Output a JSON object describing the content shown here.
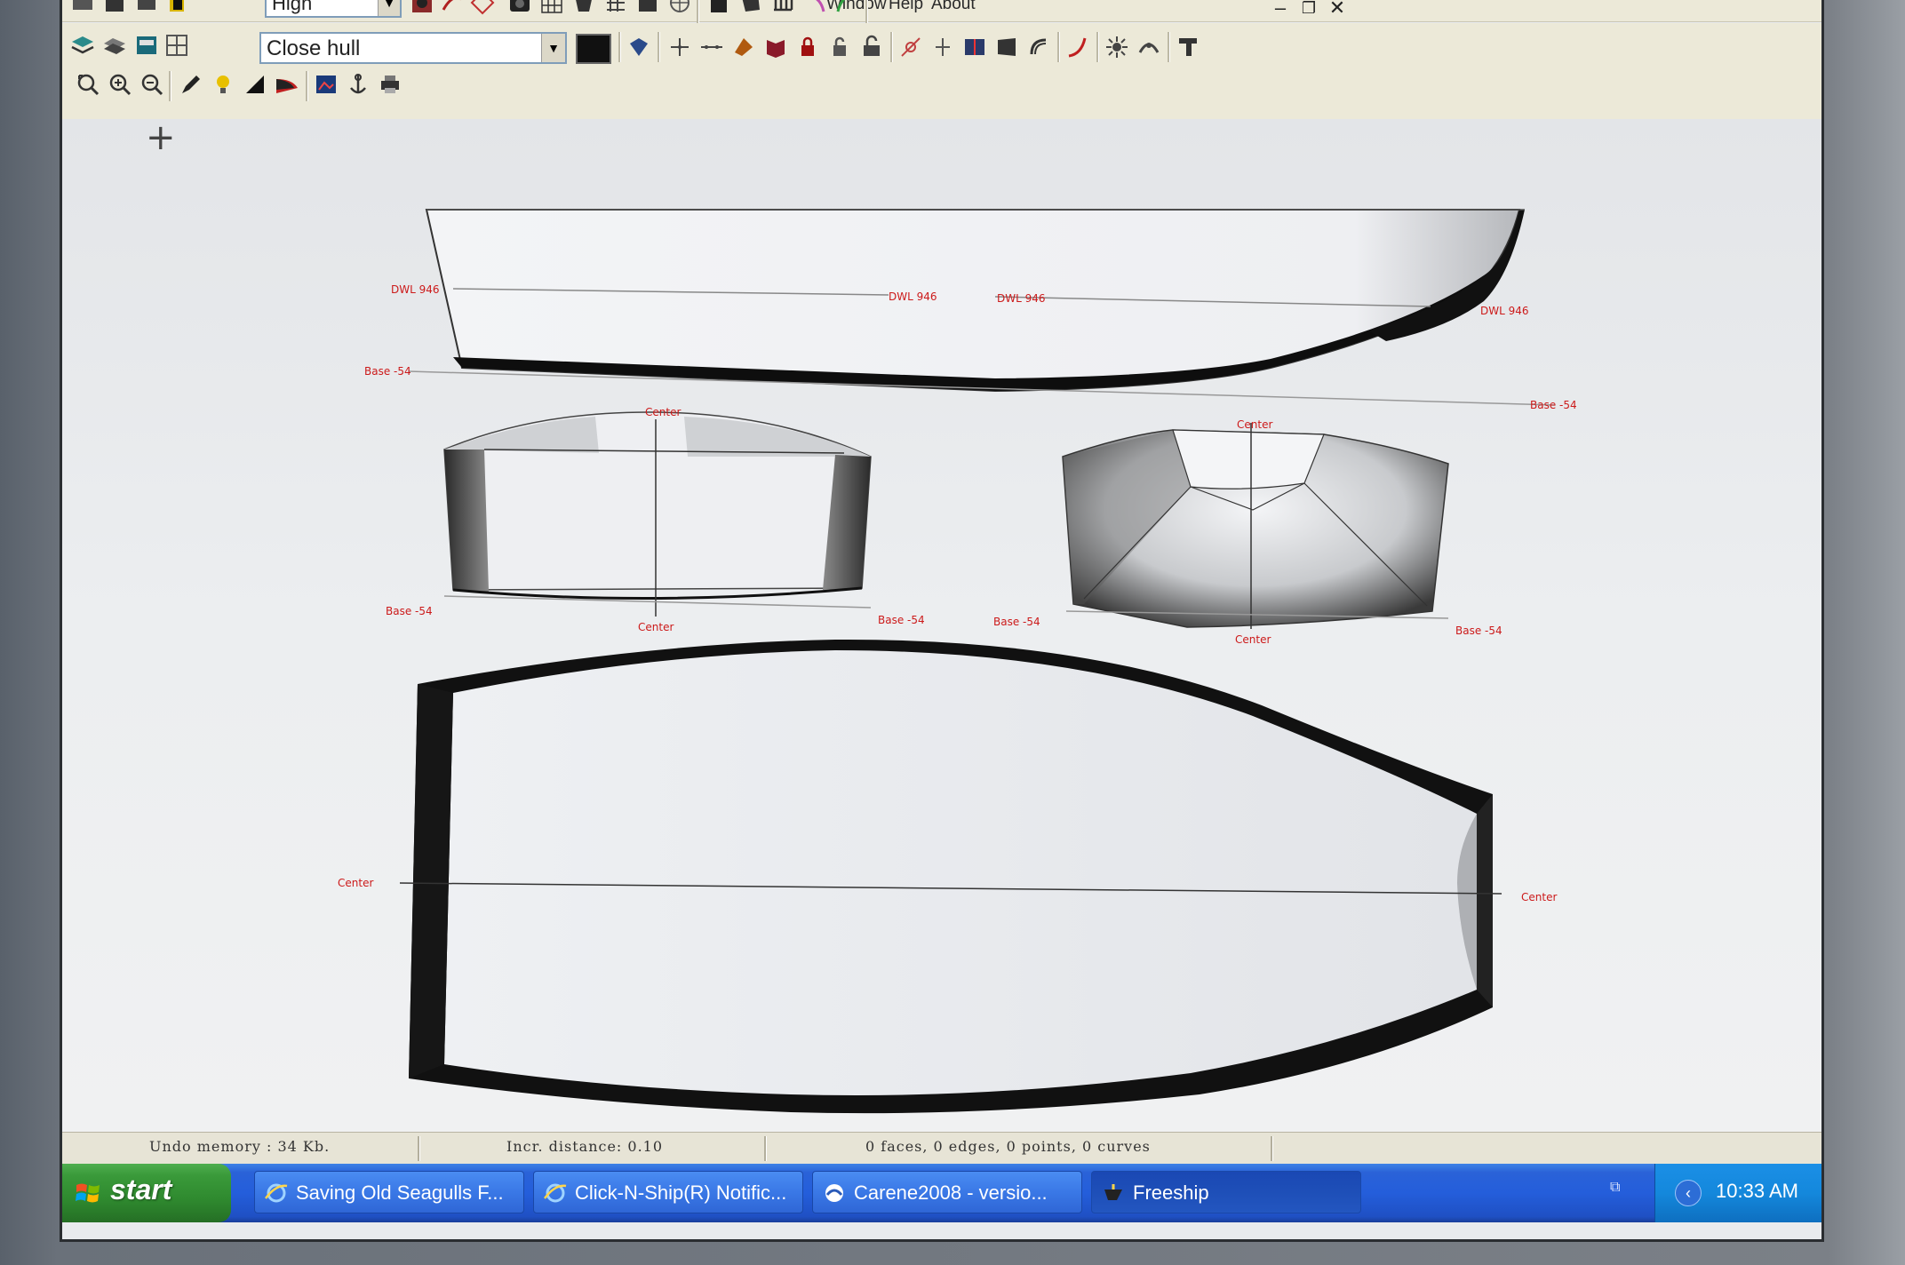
{
  "app": {
    "menu": [
      "Window",
      "Help",
      "About"
    ],
    "window_controls": {
      "minimize": "–",
      "restore": "❐",
      "close": "✕"
    }
  },
  "toolbar": {
    "precision_select": "High",
    "layer_select": "Close hull",
    "color_swatch": "#111111"
  },
  "drawing": {
    "cursor": "+",
    "profile_view": {
      "labels": [
        {
          "name": "dwl-label",
          "text": "DWL 946"
        },
        {
          "name": "dwl-label",
          "text": "DWL 946"
        },
        {
          "name": "dwl-label",
          "text": "DWL 946"
        },
        {
          "name": "dwl-label",
          "text": "DWL 946"
        },
        {
          "name": "base-label",
          "text": "Base -54"
        },
        {
          "name": "base-label",
          "text": "Base -54"
        }
      ]
    },
    "aft_body_view": {
      "center_top": "Center",
      "center_bottom": "Center",
      "base_left": "Base -54",
      "base_right": "Base -54"
    },
    "body_plan_view": {
      "center_top": "Center",
      "center_bottom": "Center",
      "base_left": "Base -54",
      "base_right": "Base -54"
    },
    "plan_view": {
      "center_left": "Center",
      "center_right": "Center"
    }
  },
  "status": {
    "undo_memory": "Undo memory : 34 Kb.",
    "incr_distance": "Incr. distance: 0.10",
    "selection": "0 faces, 0 edges, 0 points, 0 curves"
  },
  "taskbar": {
    "start_label": "start",
    "tasks": [
      {
        "label": "Saving Old Seagulls F...",
        "icon": "ie-icon",
        "active": false
      },
      {
        "label": "Click-N-Ship(R) Notific...",
        "icon": "ie-icon",
        "active": false
      },
      {
        "label": "Carene2008 - versio...",
        "icon": "carene-icon",
        "active": false
      },
      {
        "label": "Freeship",
        "icon": "freeship-icon",
        "active": true
      }
    ],
    "clock": "10:33 AM"
  },
  "colors": {
    "label_red": "#cc1a1a",
    "hull_dark": "#111111",
    "taskbar_blue": "#245edb",
    "start_green": "#3a9a3a"
  }
}
